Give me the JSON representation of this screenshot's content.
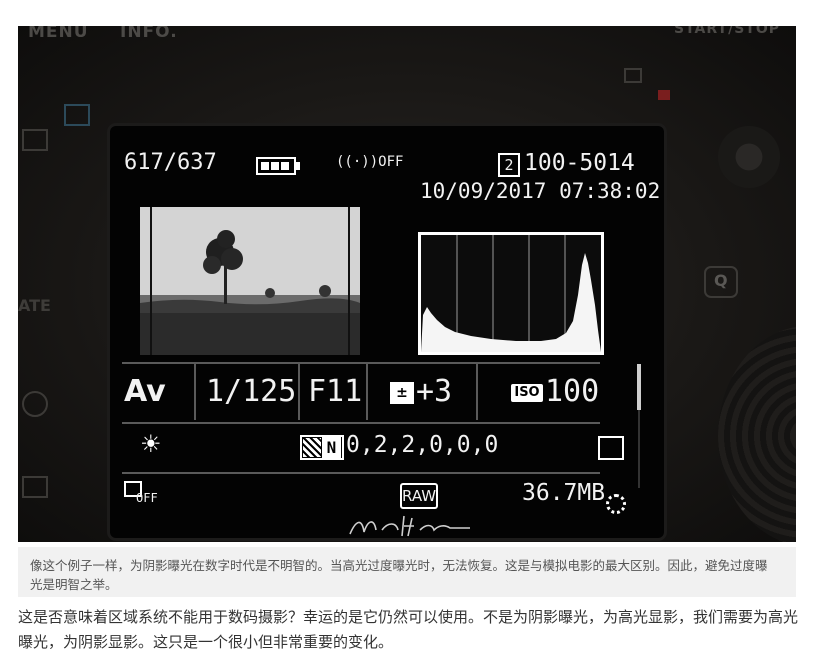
{
  "screen": {
    "shot_count": "617/637",
    "wifi": "((·))OFF",
    "folder_number": "2",
    "file_number": "100-5014",
    "datetime": "10/09/2017 07:38:02",
    "mode": "Av",
    "shutter": "1/125",
    "aperture": "F11",
    "exposure_comp": "+3",
    "iso_label": "ISO",
    "iso": "100",
    "picture_style_code": "N",
    "picture_style_values": "0,2,2,0,0,0",
    "hdr_off": "OFF",
    "format": "RAW",
    "filesize": "36.7MB"
  },
  "camera": {
    "labels": [
      "MENU",
      "INFO.",
      "START/STOP",
      "Q"
    ]
  },
  "caption": "像这个例子一样，为阴影曝光在数字时代是不明智的。当高光过度曝光时，无法恢复。这是与模拟电影的最大区别。因此，避免过度曝光是明智之举。",
  "body_text": "这是否意味着区域系统不能用于数码摄影？幸运的是它仍然可以使用。不是为阴影曝光，为高光显影，我们需要为高光曝光，为阴影显影。这只是一个很小但非常重要的变化。",
  "icons": {
    "battery": "battery-icon",
    "wifi": "wifi-off-icon",
    "exposure": "exposure-compensation-icon",
    "white_balance": "sun-icon",
    "picture_style": "picture-style-icon",
    "af_frame": "af-frame-icon",
    "hdr": "hdr-off-icon",
    "loading": "loading-icon"
  }
}
